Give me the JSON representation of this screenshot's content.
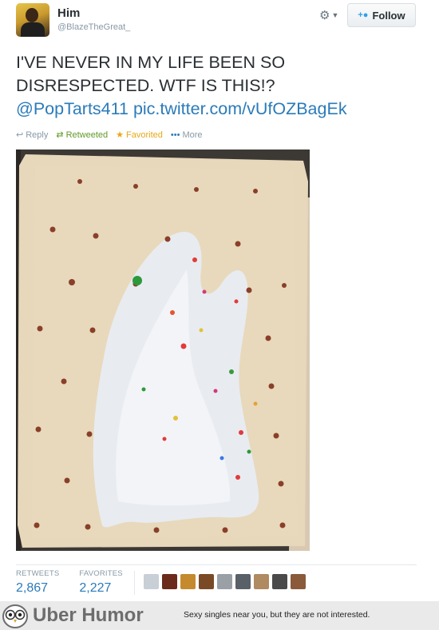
{
  "tweet": {
    "name": "Him",
    "handle": "@BlazeTheGreat_",
    "text_line1": "I'VE NEVER IN MY LIFE BEEN SO",
    "text_line2": "DISRESPECTED. WTF IS THIS!?",
    "mention": "@PopTarts411",
    "photo_link": "pic.twitter.com/vUfOZBagEk"
  },
  "header": {
    "gear_icon": "gear-icon",
    "follow_label": "Follow"
  },
  "actions": {
    "reply": "Reply",
    "retweet": "Retweeted",
    "favorite": "Favorited",
    "more": "More"
  },
  "stats": {
    "retweets_label": "RETWEETS",
    "retweets": "2,867",
    "favorites_label": "FAVORITES",
    "favorites": "2,227"
  },
  "favoriter_avatars": 9,
  "footer": {
    "brand": "Uber Humor",
    "tagline": "Sexy singles near you, but they are not interested."
  },
  "colors": {
    "link": "#2b7bb9",
    "retweet": "#609928",
    "favorite": "#e6a817",
    "muted": "#8899a6"
  }
}
